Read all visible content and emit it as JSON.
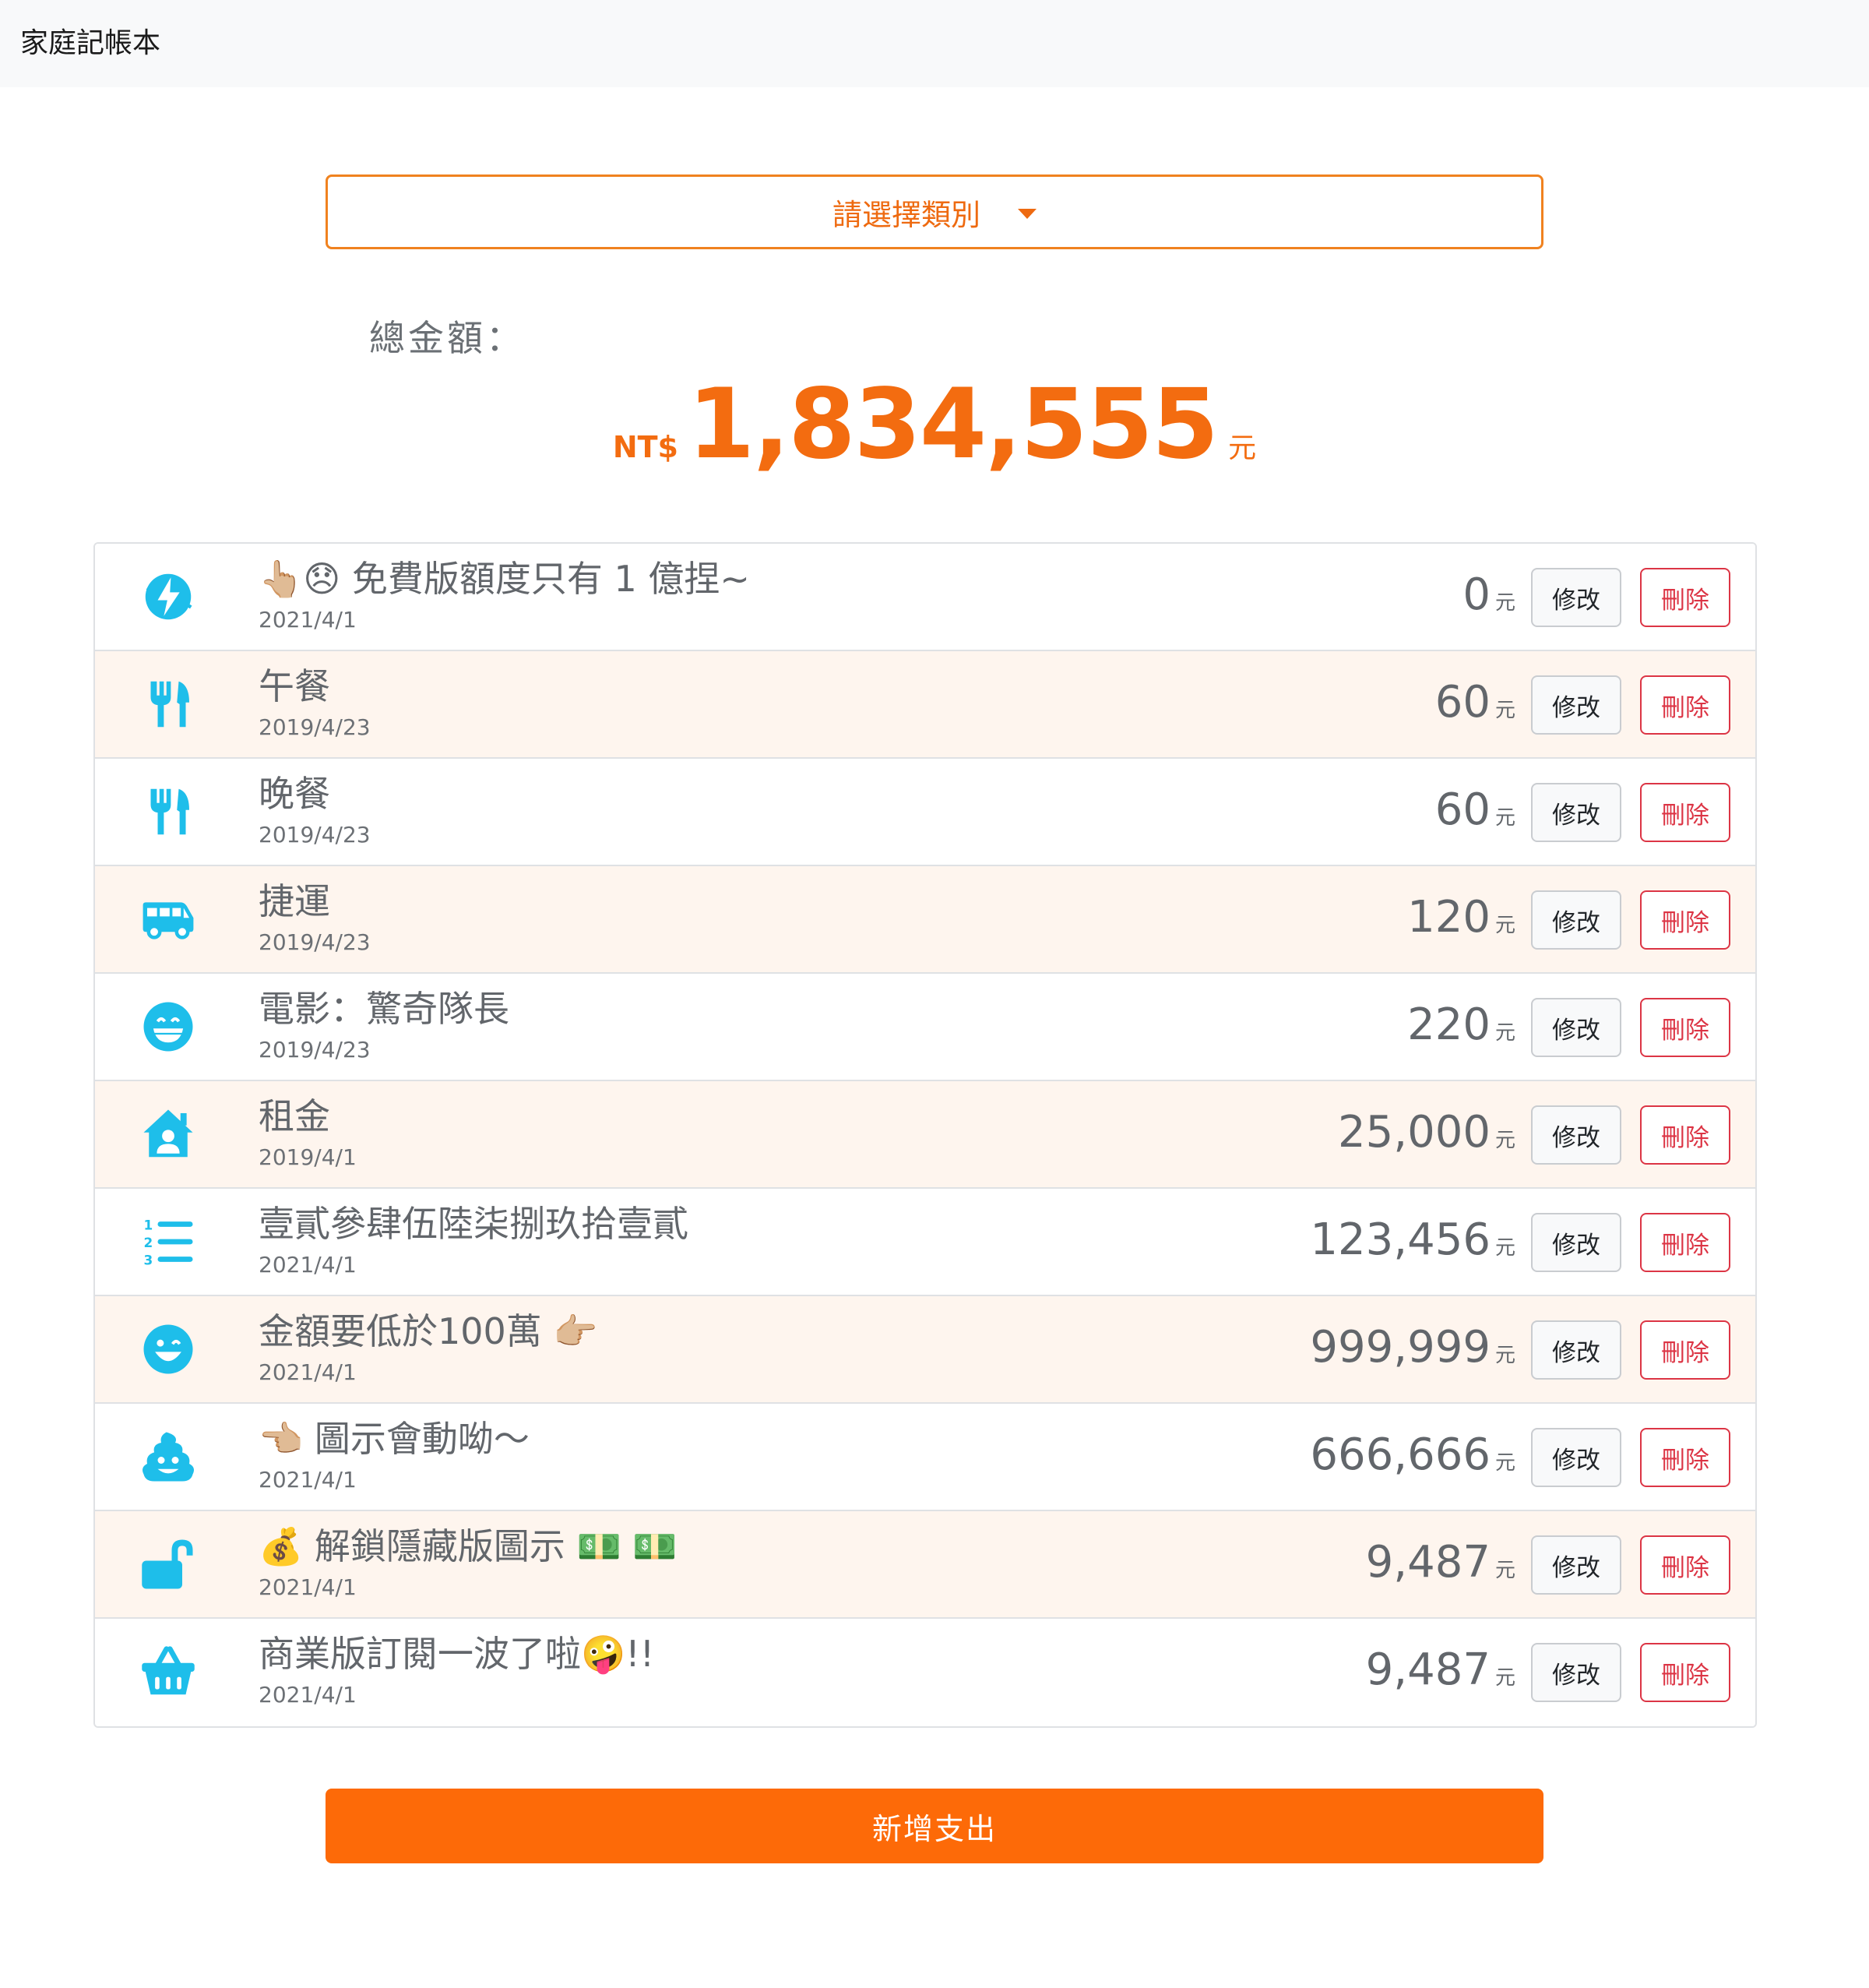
{
  "navbar": {
    "brand": "家庭記帳本"
  },
  "category_select": {
    "label": "請選擇類別"
  },
  "summary": {
    "label": "總金額：",
    "currency": "NT$",
    "amount": "1,834,555",
    "unit": "元"
  },
  "colors": {
    "accent": "#fd6a08",
    "icon": "#1ebeea",
    "danger": "#dc3545",
    "row_alt": "#fef5ee"
  },
  "buttons": {
    "edit": "修改",
    "delete": "刪除",
    "add": "新增支出"
  },
  "records": [
    {
      "icon": "bolt-icon",
      "title": "👆🏼😞 免費版額度只有 1 億捏~",
      "date": "2021/4/1",
      "amount": "0",
      "unit": "元"
    },
    {
      "icon": "utensils-icon",
      "title": "午餐",
      "date": "2019/4/23",
      "amount": "60",
      "unit": "元"
    },
    {
      "icon": "utensils-icon",
      "title": "晚餐",
      "date": "2019/4/23",
      "amount": "60",
      "unit": "元"
    },
    {
      "icon": "van-icon",
      "title": "捷運",
      "date": "2019/4/23",
      "amount": "120",
      "unit": "元"
    },
    {
      "icon": "grin-icon",
      "title": "電影：驚奇隊長",
      "date": "2019/4/23",
      "amount": "220",
      "unit": "元"
    },
    {
      "icon": "house-user-icon",
      "title": "租金",
      "date": "2019/4/1",
      "amount": "25,000",
      "unit": "元"
    },
    {
      "icon": "numbered-list-icon",
      "title": "壹貳參肆伍陸柒捌玖拾壹貳",
      "date": "2021/4/1",
      "amount": "123,456",
      "unit": "元"
    },
    {
      "icon": "smile-icon",
      "title": "金額要低於100萬 👉🏼",
      "date": "2021/4/1",
      "amount": "999,999",
      "unit": "元"
    },
    {
      "icon": "poop-icon",
      "title": "👈🏼 圖示會動呦～",
      "date": "2021/4/1",
      "amount": "666,666",
      "unit": "元"
    },
    {
      "icon": "unlock-icon",
      "title": "💰 解鎖隱藏版圖示 💵 💵",
      "date": "2021/4/1",
      "amount": "9,487",
      "unit": "元"
    },
    {
      "icon": "basket-icon",
      "title": "商業版訂閱一波了啦🤪!!",
      "date": "2021/4/1",
      "amount": "9,487",
      "unit": "元"
    }
  ]
}
